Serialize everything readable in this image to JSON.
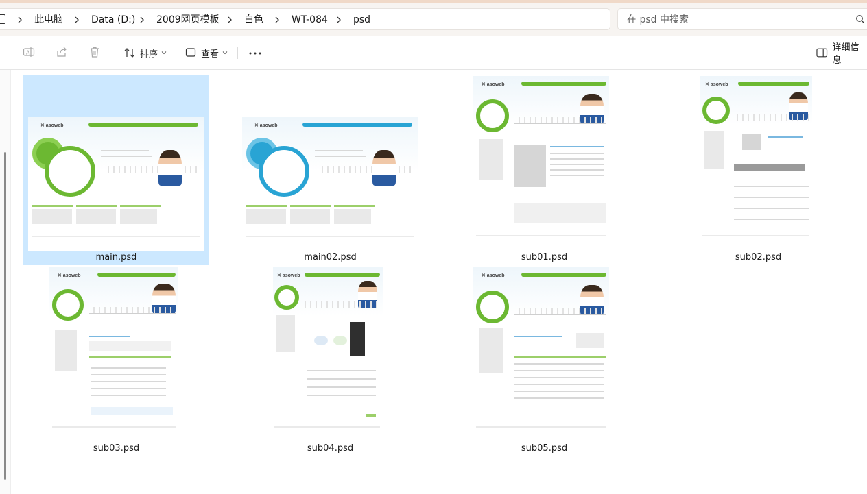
{
  "breadcrumb": [
    "此电脑",
    "Data (D:)",
    "2009网页模板",
    "白色",
    "WT-084",
    "psd"
  ],
  "search": {
    "placeholder": "在 psd 中搜索"
  },
  "toolbar": {
    "sort_label": "排序",
    "view_label": "查看",
    "details_label": "详细信息"
  },
  "files": [
    {
      "name": "main.psd",
      "selected": true,
      "color": "green"
    },
    {
      "name": "main02.psd",
      "selected": false,
      "color": "blue"
    },
    {
      "name": "sub01.psd",
      "selected": false,
      "color": "green"
    },
    {
      "name": "sub02.psd",
      "selected": false,
      "color": "green"
    },
    {
      "name": "sub03.psd",
      "selected": false,
      "color": "green"
    },
    {
      "name": "sub04.psd",
      "selected": false,
      "color": "green"
    },
    {
      "name": "sub05.psd",
      "selected": false,
      "color": "green"
    }
  ],
  "colors": {
    "selection": "#cce8ff",
    "accent_green": "#6cb832",
    "accent_blue": "#29a4d4"
  }
}
